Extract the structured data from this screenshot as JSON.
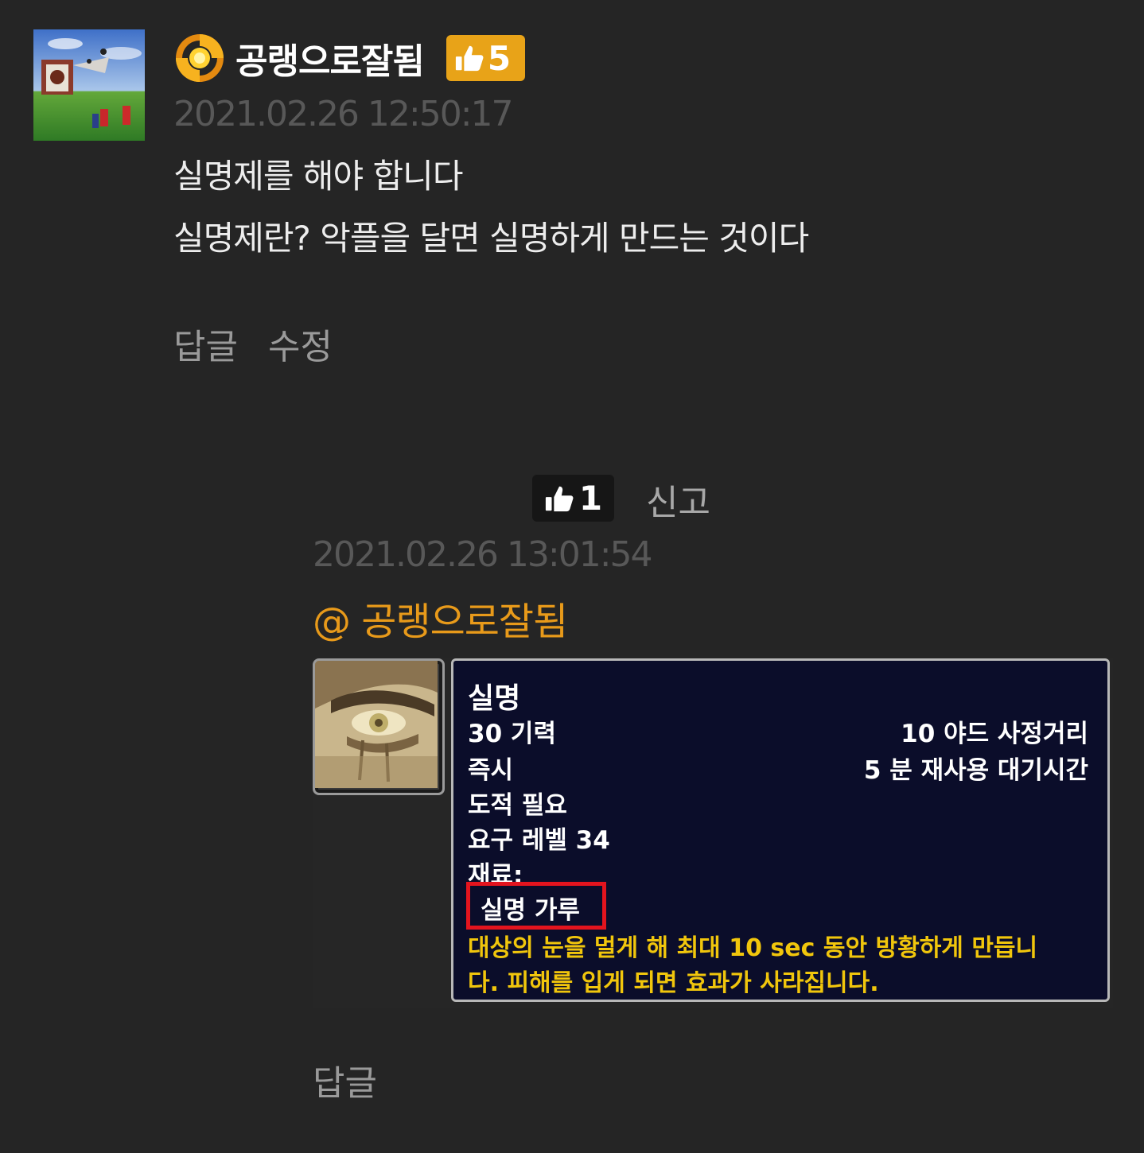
{
  "comment": {
    "author": "공랭으로잘됨",
    "likes": "5",
    "timestamp": "2021.02.26 12:50:17",
    "lines": [
      "실명제를 해야 합니다",
      "실명제란? 악플을 달면 실명하게 만드는 것이다"
    ],
    "actions": [
      "답글",
      "수정"
    ]
  },
  "reply": {
    "likes": "1",
    "report_label": "신고",
    "timestamp": "2021.02.26 13:01:54",
    "mention": "@ 공랭으로잘됨",
    "action": "답글",
    "tooltip": {
      "name": "실명",
      "cost": "30 기력",
      "range": "10 야드 사정거리",
      "cast": "즉시",
      "cooldown": "5 분 재사용 대기시간",
      "class_req": "도적 필요",
      "level_req": "요구 레벨 34",
      "reagents_label": "재료:",
      "reagent": "실명 가루",
      "description_1": "대상의 눈을 멀게 해 최대 10 sec 동안 방황하게 만듭니",
      "description_2": "다. 피해를 입게 되면 효과가 사라집니다."
    }
  },
  "colors": {
    "background": "#252525",
    "accent_orange": "#e8a318",
    "mention_orange": "#e89a1a",
    "tooltip_bg": "#0b0d2a",
    "tooltip_yellow": "#f1c60c",
    "highlight_red": "#e3141e"
  },
  "icons": {
    "level": "sun-swirl-icon",
    "like": "thumbs-up-icon",
    "spell": "blind-eye-spell-icon"
  }
}
